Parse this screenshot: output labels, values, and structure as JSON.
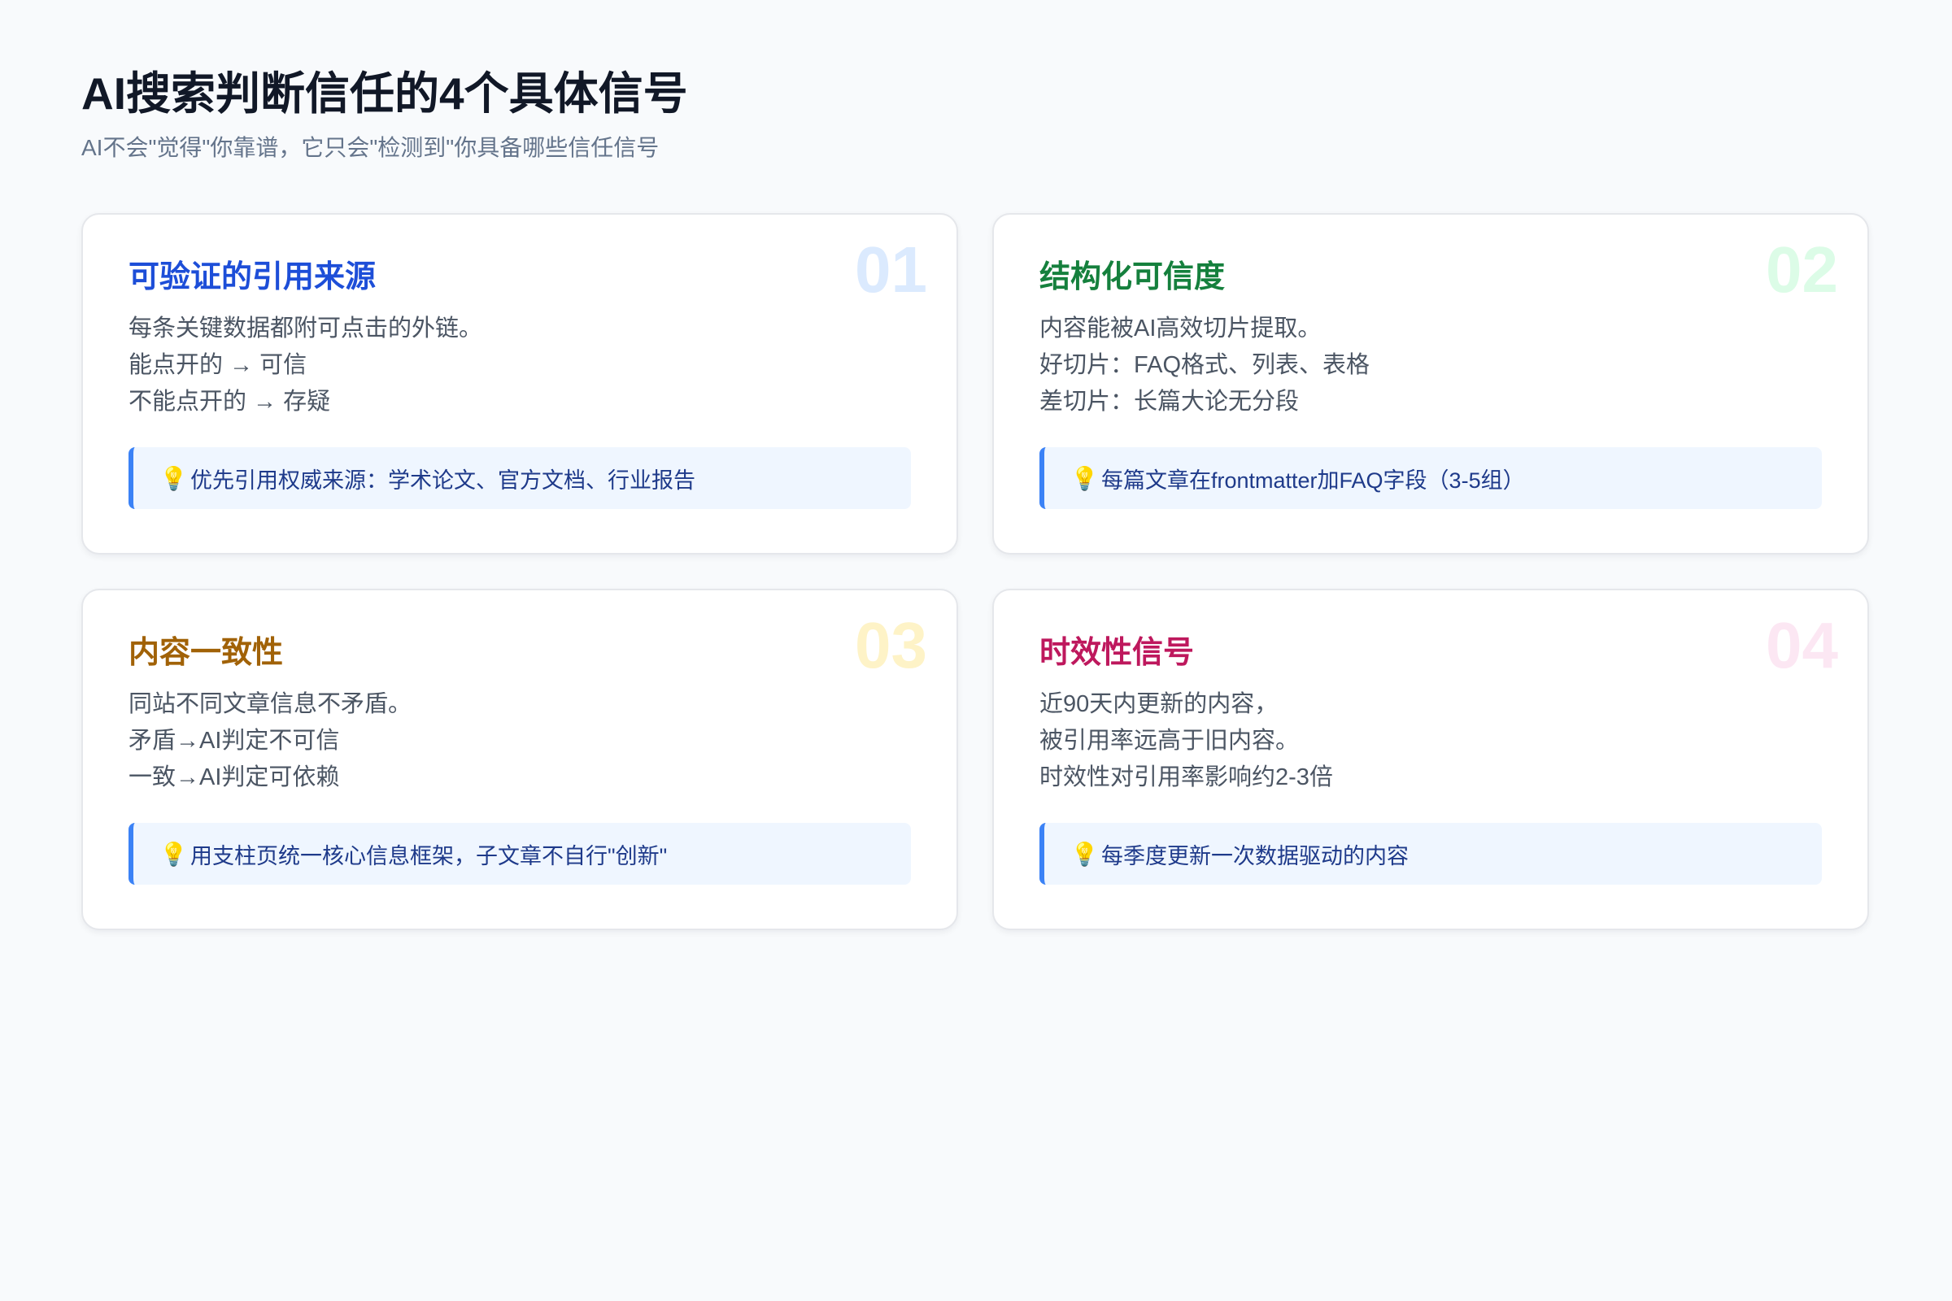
{
  "header": {
    "title": "AI搜索判断信任的4个具体信号",
    "subtitle": "AI不会\"觉得\"你靠谱，它只会\"检测到\"你具备哪些信任信号"
  },
  "tip_icon": "lightbulb-icon",
  "tip_glyph": "💡",
  "cards": [
    {
      "number": "01",
      "title": "可验证的引用来源",
      "accent_color": "#1d4ed8",
      "number_color": "#dbeafe",
      "lines": [
        "每条关键数据都附可点击的外链。",
        "能点开的 → 可信",
        "不能点开的 → 存疑"
      ],
      "tip": "优先引用权威来源：学术论文、官方文档、行业报告"
    },
    {
      "number": "02",
      "title": "结构化可信度",
      "accent_color": "#15803d",
      "number_color": "#dcfce7",
      "lines": [
        "内容能被AI高效切片提取。",
        "好切片：FAQ格式、列表、表格",
        "差切片：长篇大论无分段"
      ],
      "tip": "每篇文章在frontmatter加FAQ字段（3-5组）"
    },
    {
      "number": "03",
      "title": "内容一致性",
      "accent_color": "#a16207",
      "number_color": "#fef3c7",
      "lines": [
        "同站不同文章信息不矛盾。",
        "矛盾→AI判定不可信",
        "一致→AI判定可依赖"
      ],
      "tip": "用支柱页统一核心信息框架，子文章不自行\"创新\""
    },
    {
      "number": "04",
      "title": "时效性信号",
      "accent_color": "#be185d",
      "number_color": "#fce7f3",
      "lines": [
        "近90天内更新的内容，",
        "被引用率远高于旧内容。",
        "时效性对引用率影响约2-3倍"
      ],
      "tip": "每季度更新一次数据驱动的内容"
    }
  ]
}
